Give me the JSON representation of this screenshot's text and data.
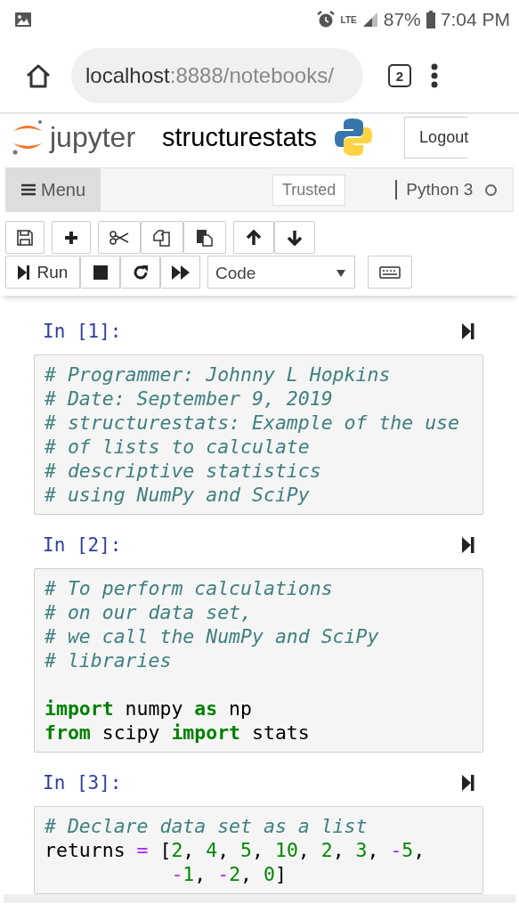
{
  "status_bar": {
    "network": "LTE",
    "battery": "87%",
    "time": "7:04 PM"
  },
  "browser": {
    "url_host": "localhost",
    "url_rest": ":8888/notebooks/",
    "tab_count": "2"
  },
  "header": {
    "logo_text": "jupyter",
    "notebook_name": "structurestats",
    "logout": "Logout"
  },
  "menubar": {
    "menu": "Menu",
    "trusted": "Trusted",
    "kernel": "Python 3",
    "kernel_busy": false
  },
  "toolbar": {
    "run": "Run",
    "cell_type": "Code"
  },
  "cells": [
    {
      "prompt": "In [1]:",
      "blocks": [
        [
          [
            {
              "kind": "comment",
              "text": "# Programmer: Johnny L Hopkins"
            }
          ],
          [
            {
              "kind": "comment",
              "text": "# Date: September 9, 2019"
            }
          ],
          [
            {
              "kind": "comment",
              "text": "# structurestats: Example of the use"
            }
          ],
          [
            {
              "kind": "comment",
              "text": "# of lists to calculate"
            }
          ],
          [
            {
              "kind": "comment",
              "text": "# descriptive statistics"
            }
          ],
          [
            {
              "kind": "comment",
              "text": "# using NumPy and SciPy"
            }
          ]
        ]
      ]
    },
    {
      "prompt": "In [2]:",
      "blocks": [
        [
          [
            {
              "kind": "comment",
              "text": "# To perform calculations"
            }
          ],
          [
            {
              "kind": "comment",
              "text": "# on our data set,"
            }
          ],
          [
            {
              "kind": "comment",
              "text": "# we call the NumPy and SciPy"
            }
          ],
          [
            {
              "kind": "comment",
              "text": "# libraries"
            }
          ]
        ],
        [
          [
            {
              "kind": "keyword",
              "text": "import"
            },
            {
              "kind": "plain",
              "text": " numpy "
            },
            {
              "kind": "keyword",
              "text": "as"
            },
            {
              "kind": "plain",
              "text": " np"
            }
          ],
          [
            {
              "kind": "keyword",
              "text": "from"
            },
            {
              "kind": "plain",
              "text": " scipy "
            },
            {
              "kind": "keyword",
              "text": "import"
            },
            {
              "kind": "plain",
              "text": " stats"
            }
          ]
        ]
      ]
    },
    {
      "prompt": "In [3]:",
      "blocks": [
        [
          [
            {
              "kind": "comment",
              "text": "# Declare data set as a list"
            }
          ],
          [
            {
              "kind": "plain",
              "text": "returns "
            },
            {
              "kind": "op",
              "text": "="
            },
            {
              "kind": "plain",
              "text": " ["
            },
            {
              "kind": "num",
              "text": "2"
            },
            {
              "kind": "plain",
              "text": ", "
            },
            {
              "kind": "num",
              "text": "4"
            },
            {
              "kind": "plain",
              "text": ", "
            },
            {
              "kind": "num",
              "text": "5"
            },
            {
              "kind": "plain",
              "text": ", "
            },
            {
              "kind": "num",
              "text": "10"
            },
            {
              "kind": "plain",
              "text": ", "
            },
            {
              "kind": "num",
              "text": "2"
            },
            {
              "kind": "plain",
              "text": ", "
            },
            {
              "kind": "num",
              "text": "3"
            },
            {
              "kind": "plain",
              "text": ", "
            },
            {
              "kind": "op",
              "text": "-"
            },
            {
              "kind": "num",
              "text": "5"
            },
            {
              "kind": "plain",
              "text": ","
            }
          ],
          [
            {
              "kind": "op",
              "text": "           -"
            },
            {
              "kind": "num",
              "text": "1"
            },
            {
              "kind": "plain",
              "text": ", "
            },
            {
              "kind": "op",
              "text": "-"
            },
            {
              "kind": "num",
              "text": "2"
            },
            {
              "kind": "plain",
              "text": ", "
            },
            {
              "kind": "num",
              "text": "0"
            },
            {
              "kind": "plain",
              "text": "]"
            }
          ]
        ]
      ]
    }
  ]
}
